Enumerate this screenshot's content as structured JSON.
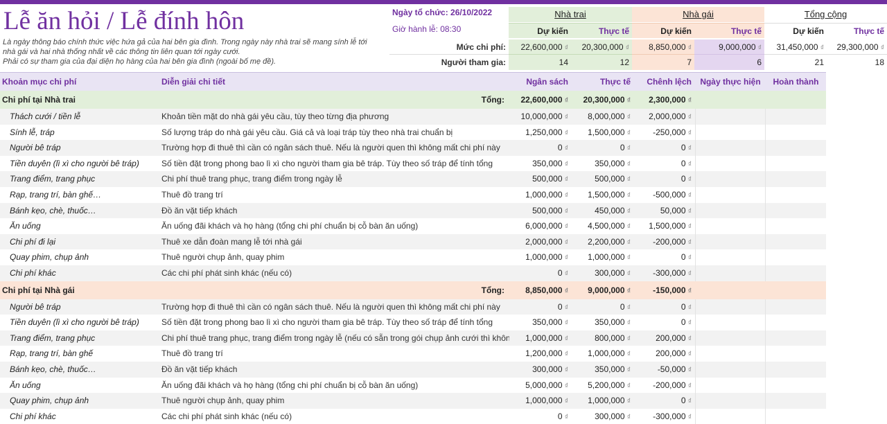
{
  "title": "Lễ ăn hỏi / Lễ đính hôn",
  "description": [
    "Là ngày thông báo chính thức việc hứa gả của hai bên gia đình. Trong ngày này nhà trai sẽ mang sính lễ tới",
    "nhà gái và hai nhà thống nhất về các thông tin liên quan tới ngày cưới.",
    "Phải có sự tham gia của đại diện họ hàng của hai bên gia đình (ngoài bố mẹ đề)."
  ],
  "event": {
    "date_label": "Ngày tổ chức: 26/10/2022",
    "time_label": "Giờ hành lễ: 08:30"
  },
  "currency_symbol": "₫",
  "summary": {
    "groom_label": "Nhà trai",
    "bride_label": "Nhà gái",
    "total_label": "Tổng cộng",
    "estimate_label": "Dự kiến",
    "actual_label": "Thực tế",
    "cost_label": "Mức chi phí:",
    "guests_label": "Người tham gia:",
    "cost": {
      "groom_est": "22,600,000",
      "groom_act": "20,300,000",
      "bride_est": "8,850,000",
      "bride_act": "9,000,000",
      "total_est": "31,450,000",
      "total_act": "29,300,000"
    },
    "guests": {
      "groom_est": "14",
      "groom_act": "12",
      "bride_est": "7",
      "bride_act": "6",
      "total_est": "21",
      "total_act": "18"
    }
  },
  "table": {
    "headers": [
      "Khoản mục chi phí",
      "Diễn giải chi tiết",
      "Ngân sách",
      "Thực tế",
      "Chênh lệch",
      "Ngày thực hiện",
      "Hoàn thành"
    ],
    "total_label": "Tổng:",
    "sections": [
      {
        "name": "Chi phí tại Nhà trai",
        "budget": "22,600,000",
        "actual": "20,300,000",
        "variance": "2,300,000",
        "rows": [
          {
            "category": "Thách cưới / tiền lễ",
            "detail": "Khoản tiền mặt do nhà gái yêu cầu, tùy theo từng địa phương",
            "budget": "10,000,000",
            "actual": "8,000,000",
            "variance": "2,000,000"
          },
          {
            "category": "Sính lễ, tráp",
            "detail": "Số lượng tráp do nhà gái yêu cầu. Giá cả và loại tráp tùy theo nhà trai chuẩn bị",
            "budget": "1,250,000",
            "actual": "1,500,000",
            "variance": "-250,000"
          },
          {
            "category": "Người bê tráp",
            "detail": "Trường hợp đi thuê thì cần có ngân sách thuê. Nếu là người quen thì không mất chi phí này",
            "budget": "0",
            "actual": "0",
            "variance": "0"
          },
          {
            "category": "Tiền duyên (lì xì cho người bê tráp)",
            "detail": "Số tiền đặt trong phong bao lì xì cho người tham gia bê tráp. Tùy theo số tráp để tính tổng",
            "budget": "350,000",
            "actual": "350,000",
            "variance": "0"
          },
          {
            "category": "Trang điểm, trang phục",
            "detail": "Chi phí thuê trang phục, trang điểm trong ngày lễ",
            "budget": "500,000",
            "actual": "500,000",
            "variance": "0"
          },
          {
            "category": "Rạp, trang trí, bàn ghế…",
            "detail": "Thuê đồ trang trí",
            "budget": "1,000,000",
            "actual": "1,500,000",
            "variance": "-500,000"
          },
          {
            "category": "Bánh kẹo, chè, thuốc…",
            "detail": "Đồ ăn vặt tiếp khách",
            "budget": "500,000",
            "actual": "450,000",
            "variance": "50,000"
          },
          {
            "category": "Ăn uống",
            "detail": "Ăn uống đãi khách và họ hàng (tổng chi phí chuẩn bị cỗ bàn ăn uống)",
            "budget": "6,000,000",
            "actual": "4,500,000",
            "variance": "1,500,000"
          },
          {
            "category": "Chi phí đi lại",
            "detail": "Thuê xe dẫn đoàn mang lễ tới nhà gái",
            "budget": "2,000,000",
            "actual": "2,200,000",
            "variance": "-200,000"
          },
          {
            "category": "Quay phim, chụp ảnh",
            "detail": "Thuê người chụp ảnh, quay phim",
            "budget": "1,000,000",
            "actual": "1,000,000",
            "variance": "0"
          },
          {
            "category": "Chi phí khác",
            "detail": "Các chi phí phát sinh khác (nếu có)",
            "budget": "0",
            "actual": "300,000",
            "variance": "-300,000"
          }
        ]
      },
      {
        "name": "Chi phí tại Nhà gái",
        "budget": "8,850,000",
        "actual": "9,000,000",
        "variance": "-150,000",
        "rows": [
          {
            "category": "Người bê tráp",
            "detail": "Trường hợp đi thuê thì cần có ngân sách thuê. Nếu là người quen thì không mất chi phí này",
            "budget": "0",
            "actual": "0",
            "variance": "0"
          },
          {
            "category": "Tiền duyên (lì xì cho người bê tráp)",
            "detail": "Số tiền đặt trong phong bao lì xì cho người tham gia bê tráp. Tùy theo số tráp để tính tổng",
            "budget": "350,000",
            "actual": "350,000",
            "variance": "0"
          },
          {
            "category": "Trang điểm, trang phục",
            "detail": "Chi phí thuê trang phục, trang điểm trong ngày lễ (nếu có sẵn trong gói chụp ảnh cưới thì không mất phí)",
            "budget": "1,000,000",
            "actual": "800,000",
            "variance": "200,000"
          },
          {
            "category": "Rạp, trang trí, bàn ghế",
            "detail": "Thuê đồ trang trí",
            "budget": "1,200,000",
            "actual": "1,000,000",
            "variance": "200,000"
          },
          {
            "category": "Bánh kẹo, chè, thuốc…",
            "detail": "Đồ ăn vặt tiếp khách",
            "budget": "300,000",
            "actual": "350,000",
            "variance": "-50,000"
          },
          {
            "category": "Ăn uống",
            "detail": "Ăn uống đãi khách và họ hàng (tổng chi phí chuẩn bị cỗ bàn ăn uống)",
            "budget": "5,000,000",
            "actual": "5,200,000",
            "variance": "-200,000"
          },
          {
            "category": "Quay phim, chụp ảnh",
            "detail": "Thuê người chụp ảnh, quay phim",
            "budget": "1,000,000",
            "actual": "1,000,000",
            "variance": "0"
          },
          {
            "category": "Chi phí khác",
            "detail": "Các chi phí phát sinh khác (nếu có)",
            "budget": "0",
            "actual": "300,000",
            "variance": "-300,000"
          }
        ]
      }
    ]
  },
  "colors": {
    "accent": "#7030a0",
    "groom_bg": "#e2efda",
    "bride_bg": "#fce4d6",
    "header_bg": "#e9e4f4",
    "alt_row_bg": "#f2f2f2"
  }
}
